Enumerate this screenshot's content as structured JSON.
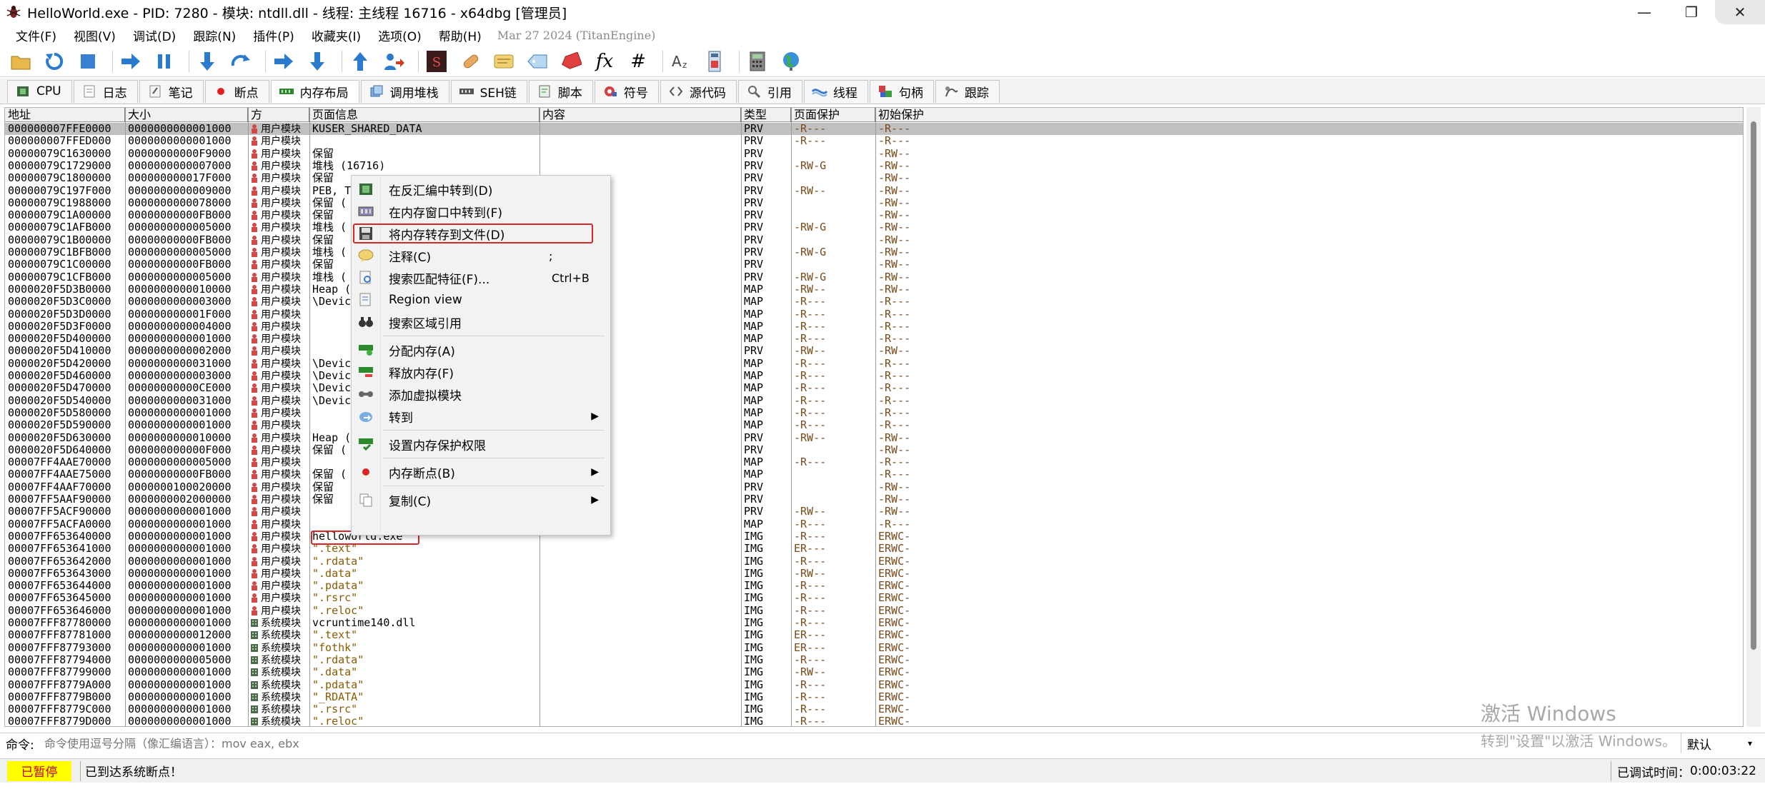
{
  "window": {
    "title": "HelloWorld.exe - PID: 7280 - 模块: ntdll.dll - 线程: 主线程 16716 - x64dbg [管理员]",
    "minimize": "—",
    "maximize": "❐",
    "close": "✕"
  },
  "menu": {
    "items": [
      "文件(F)",
      "视图(V)",
      "调试(D)",
      "跟踪(N)",
      "插件(P)",
      "收藏夹(I)",
      "选项(O)",
      "帮助(H)"
    ],
    "date": "Mar 27 2024 (TitanEngine)"
  },
  "toolbar": {
    "icons": [
      "open-icon",
      "restart-icon",
      "stop-icon",
      "run-icon",
      "pause-icon",
      "step-into-icon",
      "step-over-icon",
      "trace-into-icon",
      "trace-over-icon",
      "execute-till-return-icon",
      "run-to-user-code-icon",
      "scylla-icon",
      "patch-icon",
      "comment-icon",
      "label-icon",
      "bookmark-icon",
      "function-icon",
      "hash-icon",
      "font-icon",
      "calculator-icon",
      "settings-icon",
      "globe-icon"
    ],
    "function_glyph": "fx",
    "hash_glyph": "#"
  },
  "tabs": [
    {
      "label": "CPU",
      "icon": "cpu-icon"
    },
    {
      "label": "日志",
      "icon": "log-icon"
    },
    {
      "label": "笔记",
      "icon": "notes-icon"
    },
    {
      "label": "断点",
      "icon": "breakpoint-icon"
    },
    {
      "label": "内存布局",
      "icon": "memory-map-icon",
      "active": true
    },
    {
      "label": "调用堆栈",
      "icon": "call-stack-icon"
    },
    {
      "label": "SEH链",
      "icon": "seh-icon"
    },
    {
      "label": "脚本",
      "icon": "script-icon"
    },
    {
      "label": "符号",
      "icon": "symbols-icon"
    },
    {
      "label": "源代码",
      "icon": "source-icon"
    },
    {
      "label": "引用",
      "icon": "references-icon"
    },
    {
      "label": "线程",
      "icon": "threads-icon"
    },
    {
      "label": "句柄",
      "icon": "handles-icon"
    },
    {
      "label": "跟踪",
      "icon": "trace-icon"
    }
  ],
  "grid": {
    "headers": [
      "地址",
      "大小",
      "方",
      "页面信息",
      "内容",
      "类型",
      "页面保护",
      "初始保护"
    ],
    "rows": [
      {
        "addr": "000000007FFE0000",
        "size": "0000000000001000",
        "party": "用户模块",
        "info": "KUSER_SHARED_DATA",
        "content": "",
        "type": "PRV",
        "prot": "-R---",
        "init": "-R---",
        "selected": true
      },
      {
        "addr": "000000007FFED000",
        "size": "0000000000001000",
        "party": "用户模块",
        "info": "",
        "content": "",
        "type": "PRV",
        "prot": "-R---",
        "init": "-R---"
      },
      {
        "addr": "00000079C1630000",
        "size": "00000000000F9000",
        "party": "用户模块",
        "info": "保留",
        "content": "",
        "type": "PRV",
        "prot": "",
        "init": "-RW--"
      },
      {
        "addr": "00000079C1729000",
        "size": "0000000000007000",
        "party": "用户模块",
        "info": "堆栈 (16716)",
        "content": "",
        "type": "PRV",
        "prot": "-RW-G",
        "init": "-RW--"
      },
      {
        "addr": "00000079C1800000",
        "size": "000000000017F000",
        "party": "用户模块",
        "info": "保留",
        "content": "",
        "type": "PRV",
        "prot": "",
        "init": "-RW--"
      },
      {
        "addr": "00000079C197F000",
        "size": "0000000000009000",
        "party": "用户模块",
        "info": "PEB, T",
        "content": "",
        "type": "PRV",
        "prot": "-RW--",
        "init": "-RW--"
      },
      {
        "addr": "00000079C1988000",
        "size": "0000000000078000",
        "party": "用户模块",
        "info": "保留 (",
        "content": "",
        "type": "PRV",
        "prot": "",
        "init": "-RW--"
      },
      {
        "addr": "00000079C1A00000",
        "size": "00000000000FB000",
        "party": "用户模块",
        "info": "保留",
        "content": "",
        "type": "PRV",
        "prot": "",
        "init": "-RW--"
      },
      {
        "addr": "00000079C1AFB000",
        "size": "0000000000005000",
        "party": "用户模块",
        "info": "堆栈 (",
        "content": "",
        "type": "PRV",
        "prot": "-RW-G",
        "init": "-RW--"
      },
      {
        "addr": "00000079C1B00000",
        "size": "00000000000FB000",
        "party": "用户模块",
        "info": "保留",
        "content": "",
        "type": "PRV",
        "prot": "",
        "init": "-RW--"
      },
      {
        "addr": "00000079C1BFB000",
        "size": "0000000000005000",
        "party": "用户模块",
        "info": "堆栈 (",
        "content": "",
        "type": "PRV",
        "prot": "-RW-G",
        "init": "-RW--"
      },
      {
        "addr": "00000079C1C00000",
        "size": "00000000000FB000",
        "party": "用户模块",
        "info": "保留",
        "content": "",
        "type": "PRV",
        "prot": "",
        "init": "-RW--"
      },
      {
        "addr": "00000079C1CFB000",
        "size": "0000000000005000",
        "party": "用户模块",
        "info": "堆栈 (",
        "content": "",
        "type": "PRV",
        "prot": "-RW-G",
        "init": "-RW--"
      },
      {
        "addr": "0000020F5D3B0000",
        "size": "0000000000010000",
        "party": "用户模块",
        "info": "Heap (",
        "content": "",
        "type": "MAP",
        "prot": "-RW--",
        "init": "-RW--"
      },
      {
        "addr": "0000020F5D3C0000",
        "size": "0000000000003000",
        "party": "用户模块",
        "info": "\\Devic",
        "content": "",
        "type": "MAP",
        "prot": "-R---",
        "init": "-R---"
      },
      {
        "addr": "0000020F5D3D0000",
        "size": "000000000001F000",
        "party": "用户模块",
        "info": "",
        "content": "",
        "type": "MAP",
        "prot": "-R---",
        "init": "-R---"
      },
      {
        "addr": "0000020F5D3F0000",
        "size": "0000000000004000",
        "party": "用户模块",
        "info": "",
        "content": "",
        "type": "MAP",
        "prot": "-R---",
        "init": "-R---"
      },
      {
        "addr": "0000020F5D400000",
        "size": "0000000000001000",
        "party": "用户模块",
        "info": "",
        "content": "",
        "type": "MAP",
        "prot": "-R---",
        "init": "-R---"
      },
      {
        "addr": "0000020F5D410000",
        "size": "0000000000002000",
        "party": "用户模块",
        "info": "",
        "content": "",
        "type": "PRV",
        "prot": "-RW--",
        "init": "-RW--"
      },
      {
        "addr": "0000020F5D420000",
        "size": "0000000000031000",
        "party": "用户模块",
        "info": "\\Devic",
        "content": "",
        "type": "MAP",
        "prot": "-R---",
        "init": "-R---"
      },
      {
        "addr": "0000020F5D460000",
        "size": "0000000000003000",
        "party": "用户模块",
        "info": "\\Devic",
        "content": "",
        "type": "MAP",
        "prot": "-R---",
        "init": "-R---"
      },
      {
        "addr": "0000020F5D470000",
        "size": "00000000000CE000",
        "party": "用户模块",
        "info": "\\Devic",
        "content": "",
        "type": "MAP",
        "prot": "-R---",
        "init": "-R---"
      },
      {
        "addr": "0000020F5D540000",
        "size": "0000000000031000",
        "party": "用户模块",
        "info": "\\Devic",
        "content": "",
        "type": "MAP",
        "prot": "-R---",
        "init": "-R---"
      },
      {
        "addr": "0000020F5D580000",
        "size": "0000000000001000",
        "party": "用户模块",
        "info": "",
        "content": "",
        "type": "MAP",
        "prot": "-R---",
        "init": "-R---"
      },
      {
        "addr": "0000020F5D590000",
        "size": "0000000000001000",
        "party": "用户模块",
        "info": "",
        "content": "",
        "type": "MAP",
        "prot": "-R---",
        "init": "-R---"
      },
      {
        "addr": "0000020F5D630000",
        "size": "0000000000010000",
        "party": "用户模块",
        "info": "Heap (",
        "content": "",
        "type": "PRV",
        "prot": "-RW--",
        "init": "-RW--"
      },
      {
        "addr": "0000020F5D640000",
        "size": "000000000000F000",
        "party": "用户模块",
        "info": "保留 (",
        "content": "",
        "type": "PRV",
        "prot": "",
        "init": "-RW--"
      },
      {
        "addr": "00007FF4AAE70000",
        "size": "0000000000005000",
        "party": "用户模块",
        "info": "",
        "content": "",
        "type": "MAP",
        "prot": "-R---",
        "init": "-R---"
      },
      {
        "addr": "00007FF4AAE75000",
        "size": "00000000000FB000",
        "party": "用户模块",
        "info": "保留 (",
        "content": "",
        "type": "MAP",
        "prot": "",
        "init": "-R---"
      },
      {
        "addr": "00007FF4AAF70000",
        "size": "0000000100020000",
        "party": "用户模块",
        "info": "保留",
        "content": "",
        "type": "PRV",
        "prot": "",
        "init": "-RW--"
      },
      {
        "addr": "00007FF5AAF90000",
        "size": "0000000002000000",
        "party": "用户模块",
        "info": "保留",
        "content": "",
        "type": "PRV",
        "prot": "",
        "init": "-RW--"
      },
      {
        "addr": "00007FF5ACF90000",
        "size": "0000000000001000",
        "party": "用户模块",
        "info": "",
        "content": "",
        "type": "PRV",
        "prot": "-RW--",
        "init": "-RW--"
      },
      {
        "addr": "00007FF5ACFA0000",
        "size": "0000000000001000",
        "party": "用户模块",
        "info": "",
        "content": "",
        "type": "MAP",
        "prot": "-R---",
        "init": "-R---"
      },
      {
        "addr": "00007FF653640000",
        "size": "0000000000001000",
        "party": "用户模块",
        "info": "helloworld.exe",
        "content": "",
        "type": "IMG",
        "prot": "-R---",
        "init": "ERWC-"
      },
      {
        "addr": "00007FF653641000",
        "size": "0000000000001000",
        "party": "用户模块",
        "info": "\".text\"",
        "content": "",
        "type": "IMG",
        "prot": "ER---",
        "init": "ERWC-",
        "str": true
      },
      {
        "addr": "00007FF653642000",
        "size": "0000000000001000",
        "party": "用户模块",
        "info": "\".rdata\"",
        "content": "",
        "type": "IMG",
        "prot": "-R---",
        "init": "ERWC-",
        "str": true
      },
      {
        "addr": "00007FF653643000",
        "size": "0000000000001000",
        "party": "用户模块",
        "info": "\".data\"",
        "content": "",
        "type": "IMG",
        "prot": "-RW--",
        "init": "ERWC-",
        "str": true
      },
      {
        "addr": "00007FF653644000",
        "size": "0000000000001000",
        "party": "用户模块",
        "info": "\".pdata\"",
        "content": "",
        "type": "IMG",
        "prot": "-R---",
        "init": "ERWC-",
        "str": true
      },
      {
        "addr": "00007FF653645000",
        "size": "0000000000001000",
        "party": "用户模块",
        "info": "\".rsrc\"",
        "content": "",
        "type": "IMG",
        "prot": "-R---",
        "init": "ERWC-",
        "str": true
      },
      {
        "addr": "00007FF653646000",
        "size": "0000000000001000",
        "party": "用户模块",
        "info": "\".reloc\"",
        "content": "",
        "type": "IMG",
        "prot": "-R---",
        "init": "ERWC-",
        "str": true
      },
      {
        "addr": "00007FFF87780000",
        "size": "0000000000001000",
        "party": "系统模块",
        "info": "vcruntime140.dll",
        "content": "",
        "type": "IMG",
        "prot": "-R---",
        "init": "ERWC-"
      },
      {
        "addr": "00007FFF87781000",
        "size": "0000000000012000",
        "party": "系统模块",
        "info": "\".text\"",
        "content": "",
        "type": "IMG",
        "prot": "ER---",
        "init": "ERWC-",
        "str": true
      },
      {
        "addr": "00007FFF87793000",
        "size": "0000000000001000",
        "party": "系统模块",
        "info": "\"fothk\"",
        "content": "",
        "type": "IMG",
        "prot": "ER---",
        "init": "ERWC-",
        "str": true
      },
      {
        "addr": "00007FFF87794000",
        "size": "0000000000005000",
        "party": "系统模块",
        "info": "\".rdata\"",
        "content": "",
        "type": "IMG",
        "prot": "-R---",
        "init": "ERWC-",
        "str": true
      },
      {
        "addr": "00007FFF87799000",
        "size": "0000000000001000",
        "party": "系统模块",
        "info": "\".data\"",
        "content": "",
        "type": "IMG",
        "prot": "-RW--",
        "init": "ERWC-",
        "str": true
      },
      {
        "addr": "00007FFF8779A000",
        "size": "0000000000001000",
        "party": "系统模块",
        "info": "\".pdata\"",
        "content": "",
        "type": "IMG",
        "prot": "-R---",
        "init": "ERWC-",
        "str": true
      },
      {
        "addr": "00007FFF8779B000",
        "size": "0000000000001000",
        "party": "系统模块",
        "info": "\"_RDATA\"",
        "content": "",
        "type": "IMG",
        "prot": "-R---",
        "init": "ERWC-",
        "str": true
      },
      {
        "addr": "00007FFF8779C000",
        "size": "0000000000001000",
        "party": "系统模块",
        "info": "\".rsrc\"",
        "content": "",
        "type": "IMG",
        "prot": "-R---",
        "init": "ERWC-",
        "str": true
      },
      {
        "addr": "00007FFF8779D000",
        "size": "0000000000001000",
        "party": "系统模块",
        "info": "\".reloc\"",
        "content": "",
        "type": "IMG",
        "prot": "-R---",
        "init": "ERWC-",
        "str": true
      }
    ]
  },
  "context_menu": {
    "items": [
      {
        "label": "在反汇编中转到(D)",
        "icon": "disassembly-icon",
        "shortcut": "",
        "submenu": false
      },
      {
        "label": "在内存窗口中转到(F)",
        "icon": "dump-icon",
        "shortcut": "",
        "submenu": false
      },
      {
        "label": "将内存转存到文件(D)",
        "icon": "save-icon",
        "shortcut": "",
        "submenu": false,
        "highlighted": true
      },
      {
        "label": "注释(C)",
        "icon": "comment-icon",
        "shortcut": ";",
        "submenu": false
      },
      {
        "label": "搜索匹配特征(F)...",
        "icon": "search-pattern-icon",
        "shortcut": "Ctrl+B",
        "submenu": false
      },
      {
        "label": "Region view",
        "icon": "region-view-icon",
        "shortcut": "",
        "submenu": false
      },
      {
        "label": "搜索区域引用",
        "icon": "binoculars-icon",
        "shortcut": "",
        "submenu": false,
        "sep_after": true
      },
      {
        "label": "分配内存(A)",
        "icon": "memory-alloc-icon",
        "shortcut": "",
        "submenu": false
      },
      {
        "label": "释放内存(F)",
        "icon": "memory-free-icon",
        "shortcut": "",
        "submenu": false
      },
      {
        "label": "添加虚拟模块",
        "icon": "virtual-module-icon",
        "shortcut": "",
        "submenu": false
      },
      {
        "label": "转到",
        "icon": "goto-icon",
        "shortcut": "",
        "submenu": true,
        "sep_after": true
      },
      {
        "label": "设置内存保护权限",
        "icon": "memory-protect-icon",
        "shortcut": "",
        "submenu": false,
        "sep_after": true
      },
      {
        "label": "内存断点(B)",
        "icon": "memory-breakpoint-icon",
        "shortcut": "",
        "submenu": true,
        "sep_after": true
      },
      {
        "label": "复制(C)",
        "icon": "copy-icon",
        "shortcut": "",
        "submenu": true
      }
    ],
    "arrow": "▶"
  },
  "command": {
    "label": "命令:",
    "placeholder": "命令使用逗号分隔（像汇编语言）：mov eax, ebx",
    "mode": "默认",
    "caret": "▾"
  },
  "status": {
    "state": "已暂停",
    "message": "已到达系统断点！",
    "time_label": "已调试时间：",
    "time": "0:00:03:22"
  },
  "watermark": {
    "line1": "激活 Windows",
    "line2": "转到\"设置\"以激活 Windows。"
  },
  "colors": {
    "selected_row": "#c0c0c0",
    "highlight_box": "#d62828",
    "status_state_bg": "#ffff00",
    "status_state_fg": "#c00000",
    "string_text": "#8b5a00"
  }
}
